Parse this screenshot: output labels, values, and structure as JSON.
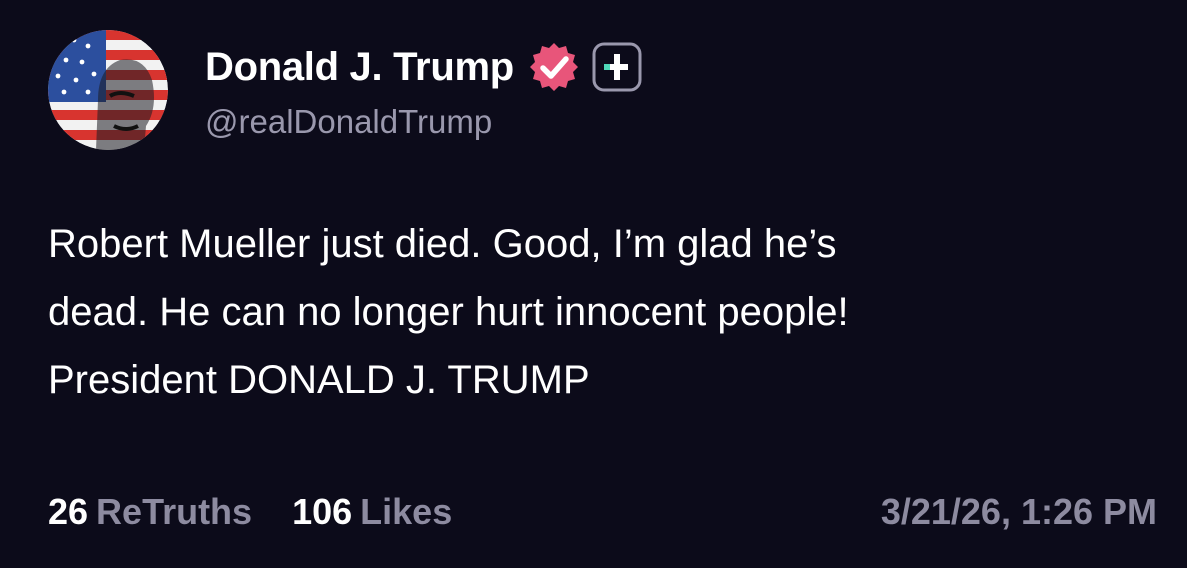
{
  "author": {
    "display_name": "Donald J. Trump",
    "handle": "@realDonaldTrump",
    "verified_badge_icon": "verified-check-badge",
    "verified_badge_color": "#e8557a",
    "plus_badge_icon": "plus-badge",
    "plus_accent_color": "#4fd8b8"
  },
  "post": {
    "lines": [
      "Robert Mueller just died. Good, I’m glad he’s",
      "dead. He can no longer hurt innocent people!",
      "President DONALD J. TRUMP"
    ]
  },
  "stats": {
    "retruths_count": "26",
    "retruths_label": "ReTruths",
    "likes_count": "106",
    "likes_label": "Likes"
  },
  "timestamp": "3/21/26, 1:26 PM",
  "colors": {
    "background": "#0c0b1a",
    "text_primary": "#ffffff",
    "text_secondary": "#8d8ba0"
  }
}
